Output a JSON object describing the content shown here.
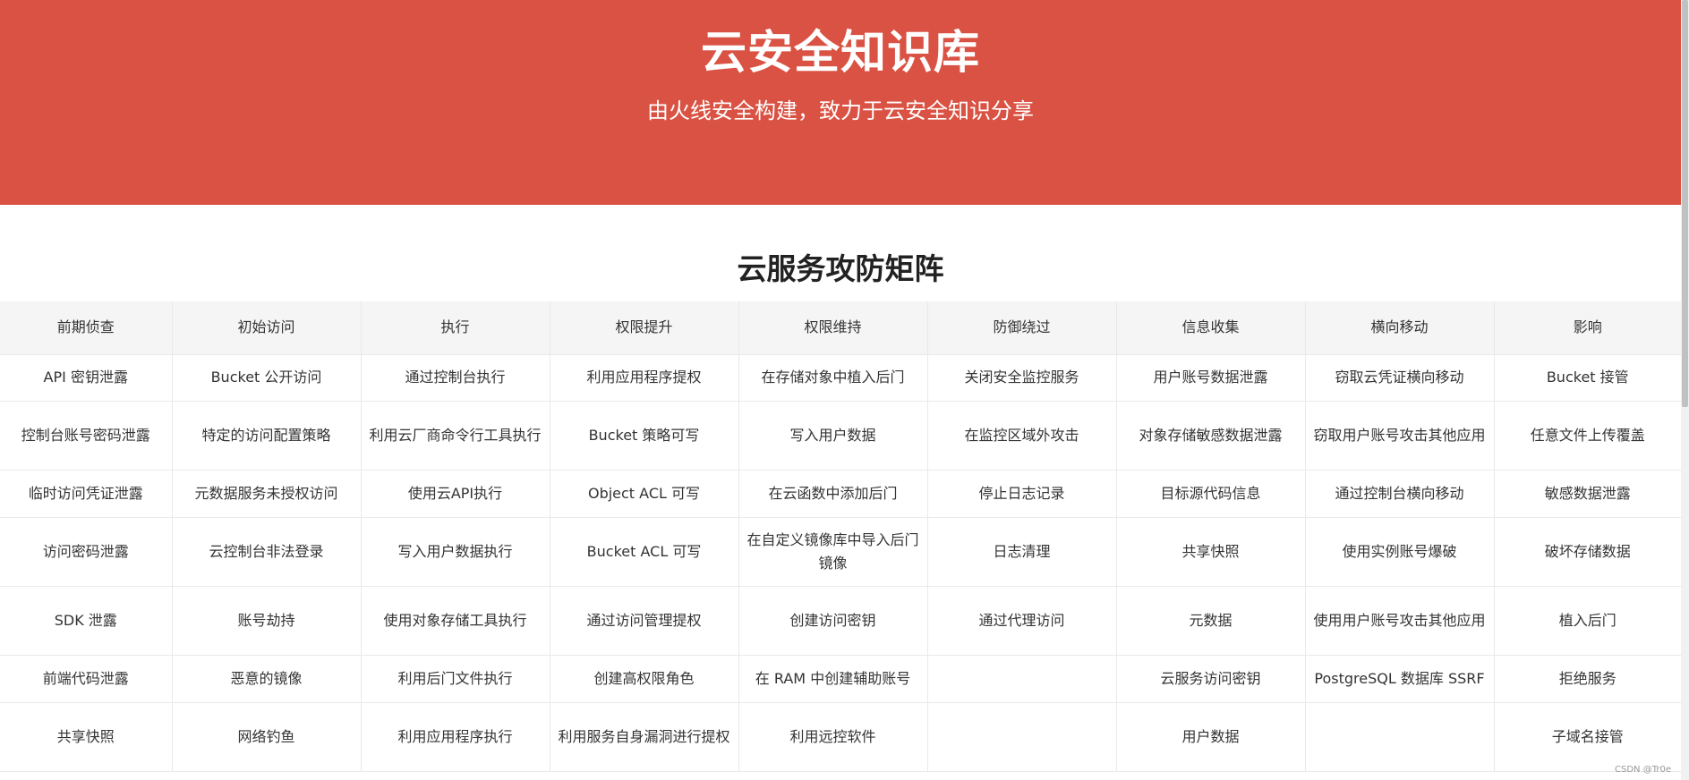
{
  "hero": {
    "title": "云安全知识库",
    "subtitle": "由火线安全构建，致力于云安全知识分享",
    "color": "#d95243"
  },
  "section": {
    "title": "云服务攻防矩阵"
  },
  "matrix": {
    "columns": [
      "前期侦查",
      "初始访问",
      "执行",
      "权限提升",
      "权限维持",
      "防御绕过",
      "信息收集",
      "横向移动",
      "影响"
    ],
    "rows": [
      [
        "API 密钥泄露",
        "Bucket 公开访问",
        "通过控制台执行",
        "利用应用程序提权",
        "在存储对象中植入后门",
        "关闭安全监控服务",
        "用户账号数据泄露",
        "窃取云凭证横向移动",
        "Bucket 接管"
      ],
      [
        "控制台账号密码泄露",
        "特定的访问配置策略",
        "利用云厂商命令行工具执行",
        "Bucket 策略可写",
        "写入用户数据",
        "在监控区域外攻击",
        "对象存储敏感数据泄露",
        "窃取用户账号攻击其他应用",
        "任意文件上传覆盖"
      ],
      [
        "临时访问凭证泄露",
        "元数据服务未授权访问",
        "使用云API执行",
        "Object ACL 可写",
        "在云函数中添加后门",
        "停止日志记录",
        "目标源代码信息",
        "通过控制台横向移动",
        "敏感数据泄露"
      ],
      [
        "访问密码泄露",
        "云控制台非法登录",
        "写入用户数据执行",
        "Bucket ACL 可写",
        "在自定义镜像库中导入后门镜像",
        "日志清理",
        "共享快照",
        "使用实例账号爆破",
        "破坏存储数据"
      ],
      [
        "SDK 泄露",
        "账号劫持",
        "使用对象存储工具执行",
        "通过访问管理提权",
        "创建访问密钥",
        "通过代理访问",
        "元数据",
        "使用用户账号攻击其他应用",
        "植入后门"
      ],
      [
        "前端代码泄露",
        "恶意的镜像",
        "利用后门文件执行",
        "创建高权限角色",
        "在 RAM 中创建辅助账号",
        "",
        "云服务访问密钥",
        "PostgreSQL 数据库 SSRF",
        "拒绝服务"
      ],
      [
        "共享快照",
        "网络钓鱼",
        "利用应用程序执行",
        "利用服务自身漏洞进行提权",
        "利用远控软件",
        "",
        "用户数据",
        "",
        "子域名接管"
      ]
    ]
  },
  "watermark": "CSDN @Tr0e"
}
